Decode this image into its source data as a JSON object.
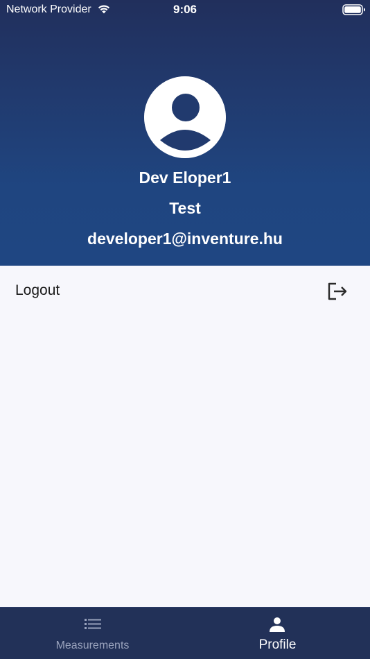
{
  "status_bar": {
    "carrier": "Network Provider",
    "time": "9:06"
  },
  "profile": {
    "name": "Dev Eloper1",
    "organization": "Test",
    "email": "developer1@inventure.hu"
  },
  "actions": {
    "logout_label": "Logout",
    "logout_icon": "logout-icon"
  },
  "tab_bar": {
    "tabs": [
      {
        "label": "Measurements",
        "icon": "list-icon",
        "selected": false
      },
      {
        "label": "Profile",
        "icon": "person-icon",
        "selected": true
      }
    ]
  },
  "colors": {
    "header_top": "#212f5c",
    "header_bottom": "#1f4682",
    "background": "#f7f7fc",
    "tab_bar": "#223158",
    "tab_inactive": "#9aa3bd",
    "tab_active": "#ffffff"
  }
}
